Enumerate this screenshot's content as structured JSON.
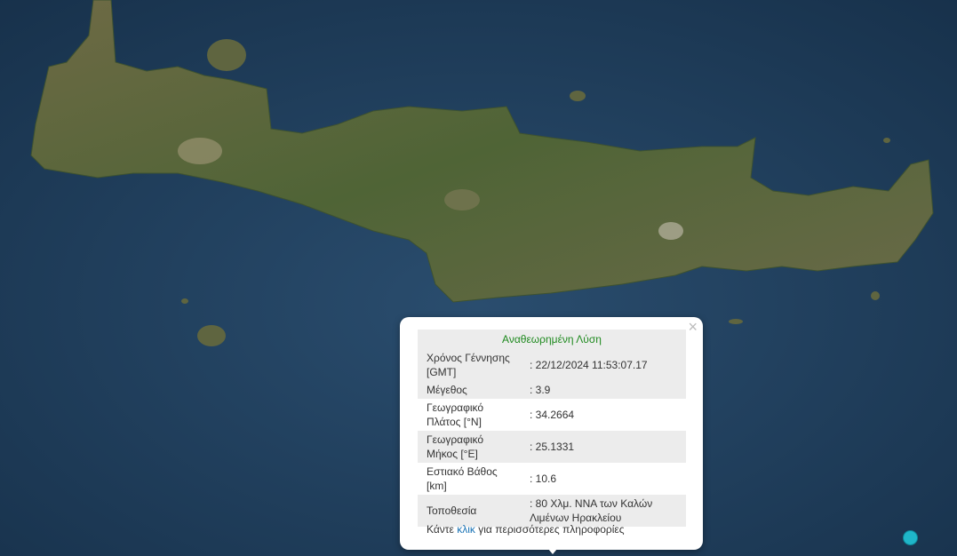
{
  "popup": {
    "title": "Αναθεωρημένη Λύση",
    "close_icon": "close-icon",
    "rows": [
      {
        "label": "Χρόνος Γέννησης [GMT]",
        "value": ": 22/12/2024 11:53:07.17"
      },
      {
        "label": "Μέγεθος",
        "value": ": 3.9"
      },
      {
        "label": "Γεωγραφικό Πλάτος [°N]",
        "value": ": 34.2664"
      },
      {
        "label": "Γεωγραφικό Μήκος [°E]",
        "value": ": 25.1331"
      },
      {
        "label": "Εστιακό Βάθος [km]",
        "value": ": 10.6"
      },
      {
        "label": "Τοποθεσία",
        "value": ": 80 Χλμ. ΝΝΑ των Καλών Λιμένων Ηρακλείου"
      }
    ],
    "more_prefix": "Κάντε",
    "more_link": "κλικ",
    "more_suffix": "για περισσότερες πληροφορίες"
  },
  "map": {
    "sea_color": "#1d3a55",
    "land_color": "#5a6a3e",
    "marker_color": "#1fb6c9"
  }
}
